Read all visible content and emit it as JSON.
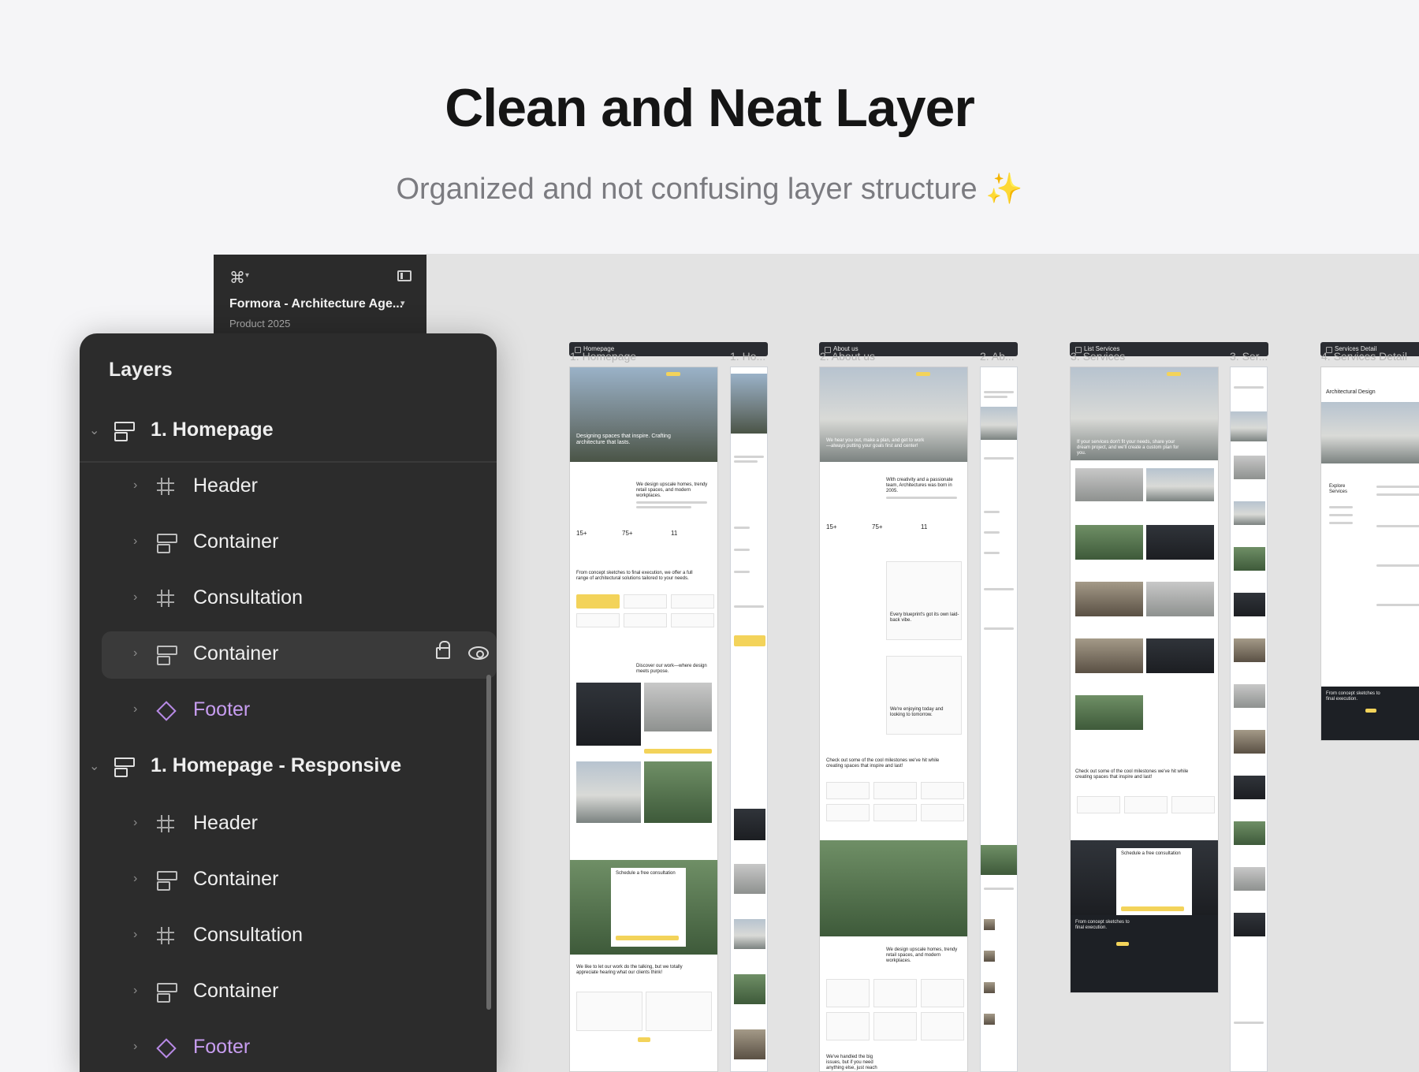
{
  "hero": {
    "title": "Clean and Neat Layer",
    "subtitle": "Organized and not confusing layer structure",
    "sparkle": "✨"
  },
  "file_panel": {
    "file_name": "Formora - Architecture Age...",
    "project": "Product 2025"
  },
  "layers": {
    "title": "Layers",
    "rows": [
      {
        "label": "1. Homepage",
        "type": "section"
      },
      {
        "label": "Header",
        "type": "frame"
      },
      {
        "label": "Container",
        "type": "stack"
      },
      {
        "label": "Consultation",
        "type": "frame"
      },
      {
        "label": "Container",
        "type": "stack",
        "selected": true
      },
      {
        "label": "Footer",
        "type": "component"
      },
      {
        "label": "1. Homepage - Responsive",
        "type": "section"
      },
      {
        "label": "Header",
        "type": "frame"
      },
      {
        "label": "Container",
        "type": "stack"
      },
      {
        "label": "Consultation",
        "type": "frame"
      },
      {
        "label": "Container",
        "type": "stack"
      },
      {
        "label": "Footer",
        "type": "component"
      }
    ]
  },
  "canvas": {
    "frames": [
      {
        "tag": "Homepage",
        "caption": "1. Homepage",
        "caption_narrow": "1. Ho...",
        "hero_text": "Designing spaces that inspire. Crafting architecture that lasts.",
        "intro": "We design upscale homes, trendy retail spaces, and modern workplaces.",
        "stats": [
          "15+",
          "75+",
          "11"
        ],
        "services_heading": "From concept sketches to final execution, we offer a full range of architectural solutions tailored to your needs.",
        "work_heading": "Discover our work—where design meets purpose.",
        "consult_heading": "Schedule a free consultation",
        "testimonial_heading": "We like to let our work do the talking, but we totally appreciate hearing what our clients think!"
      },
      {
        "tag": "About us",
        "caption": "2. About us",
        "caption_narrow": "2. Ab...",
        "hero_text": "We hear you out, make a plan, and get to work—always putting your goals first and center!",
        "intro": "With creativity and a passionate team, Architectures was born in 2005.",
        "stats": [
          "15+",
          "75+",
          "11"
        ],
        "quote_1": "Every blueprint's got its own laid-back vibe.",
        "quote_2": "We're enjoying today and looking to tomorrow.",
        "milestone_heading": "Check out some of the cool milestones we've hit while creating spaces that inspire and last!",
        "team_heading": "We design upscale homes, trendy retail spaces, and modern workplaces.",
        "faq_heading": "We've handled the big issues, but if you need anything else, just reach out!"
      },
      {
        "tag": "List Services",
        "caption": "3. Services",
        "caption_narrow": "3. Ser...",
        "hero_text": "If your services don't fit your needs, share your dream project, and we'll create a custom plan for you.",
        "milestone_heading": "Check out some of the cool milestones we've hit while creating spaces that inspire and last!",
        "consult_heading": "Schedule a free consultation",
        "footer_heading": "From concept sketches to final execution."
      },
      {
        "tag": "Services Detail",
        "caption": "4. Services Detail",
        "page_title": "Architectural Design",
        "side_title": "Explore Services",
        "footer_heading": "From concept sketches to final execution."
      }
    ]
  }
}
